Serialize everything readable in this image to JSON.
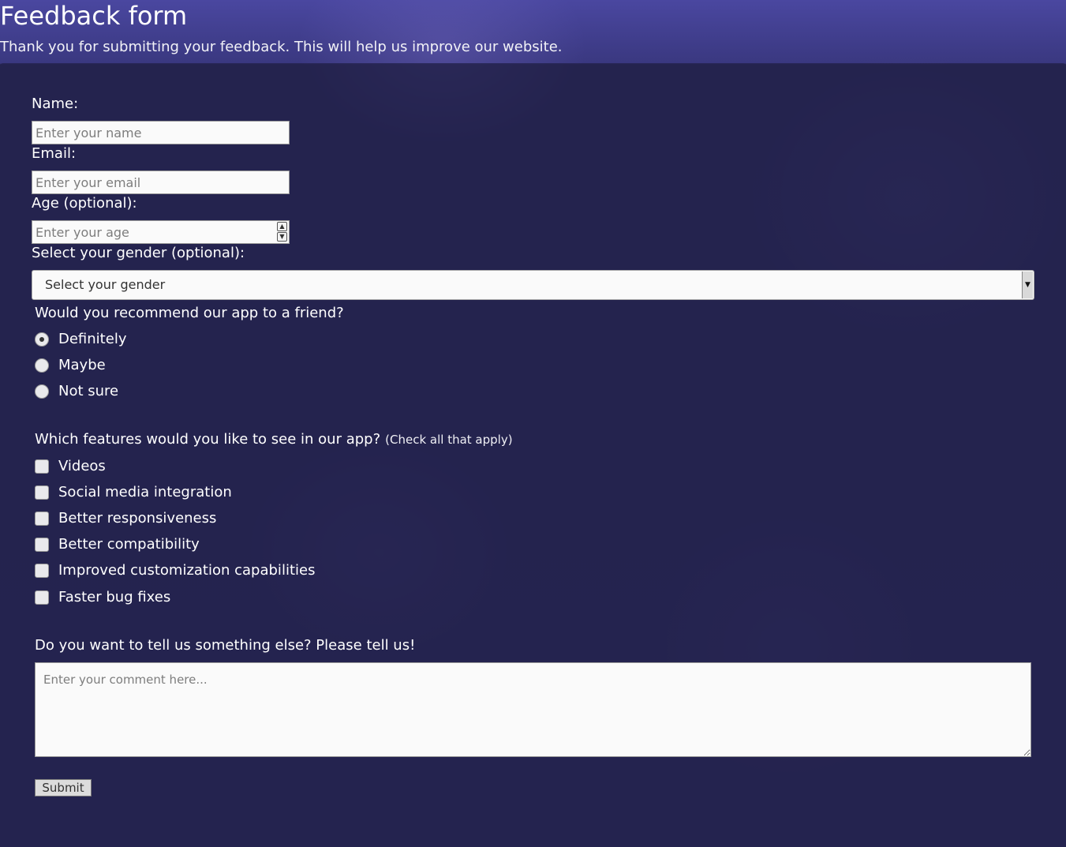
{
  "header": {
    "title": "Feedback form",
    "subtitle": "Thank you for submitting your feedback. This will help us improve our website."
  },
  "form": {
    "name": {
      "label": "Name:",
      "placeholder": "Enter your name"
    },
    "email": {
      "label": "Email:",
      "placeholder": "Enter your email"
    },
    "age": {
      "label": "Age (optional):",
      "placeholder": "Enter your age"
    },
    "gender": {
      "label": "Select your gender (optional):",
      "selected": "Select your gender"
    },
    "recommend": {
      "question": "Would you recommend our app to a friend?",
      "options": [
        "Definitely",
        "Maybe",
        "Not sure"
      ],
      "selected": "Definitely"
    },
    "features": {
      "question": "Which features would you like to see in our app?",
      "hint": "(Check all that apply)",
      "options": [
        "Videos",
        "Social media integration",
        "Better responsiveness",
        "Better compatibility",
        "Improved customization capabilities",
        "Faster bug fixes"
      ]
    },
    "comment": {
      "label": "Do you want to tell us something else? Please tell us!",
      "placeholder": "Enter your comment here..."
    },
    "submit_label": "Submit"
  }
}
